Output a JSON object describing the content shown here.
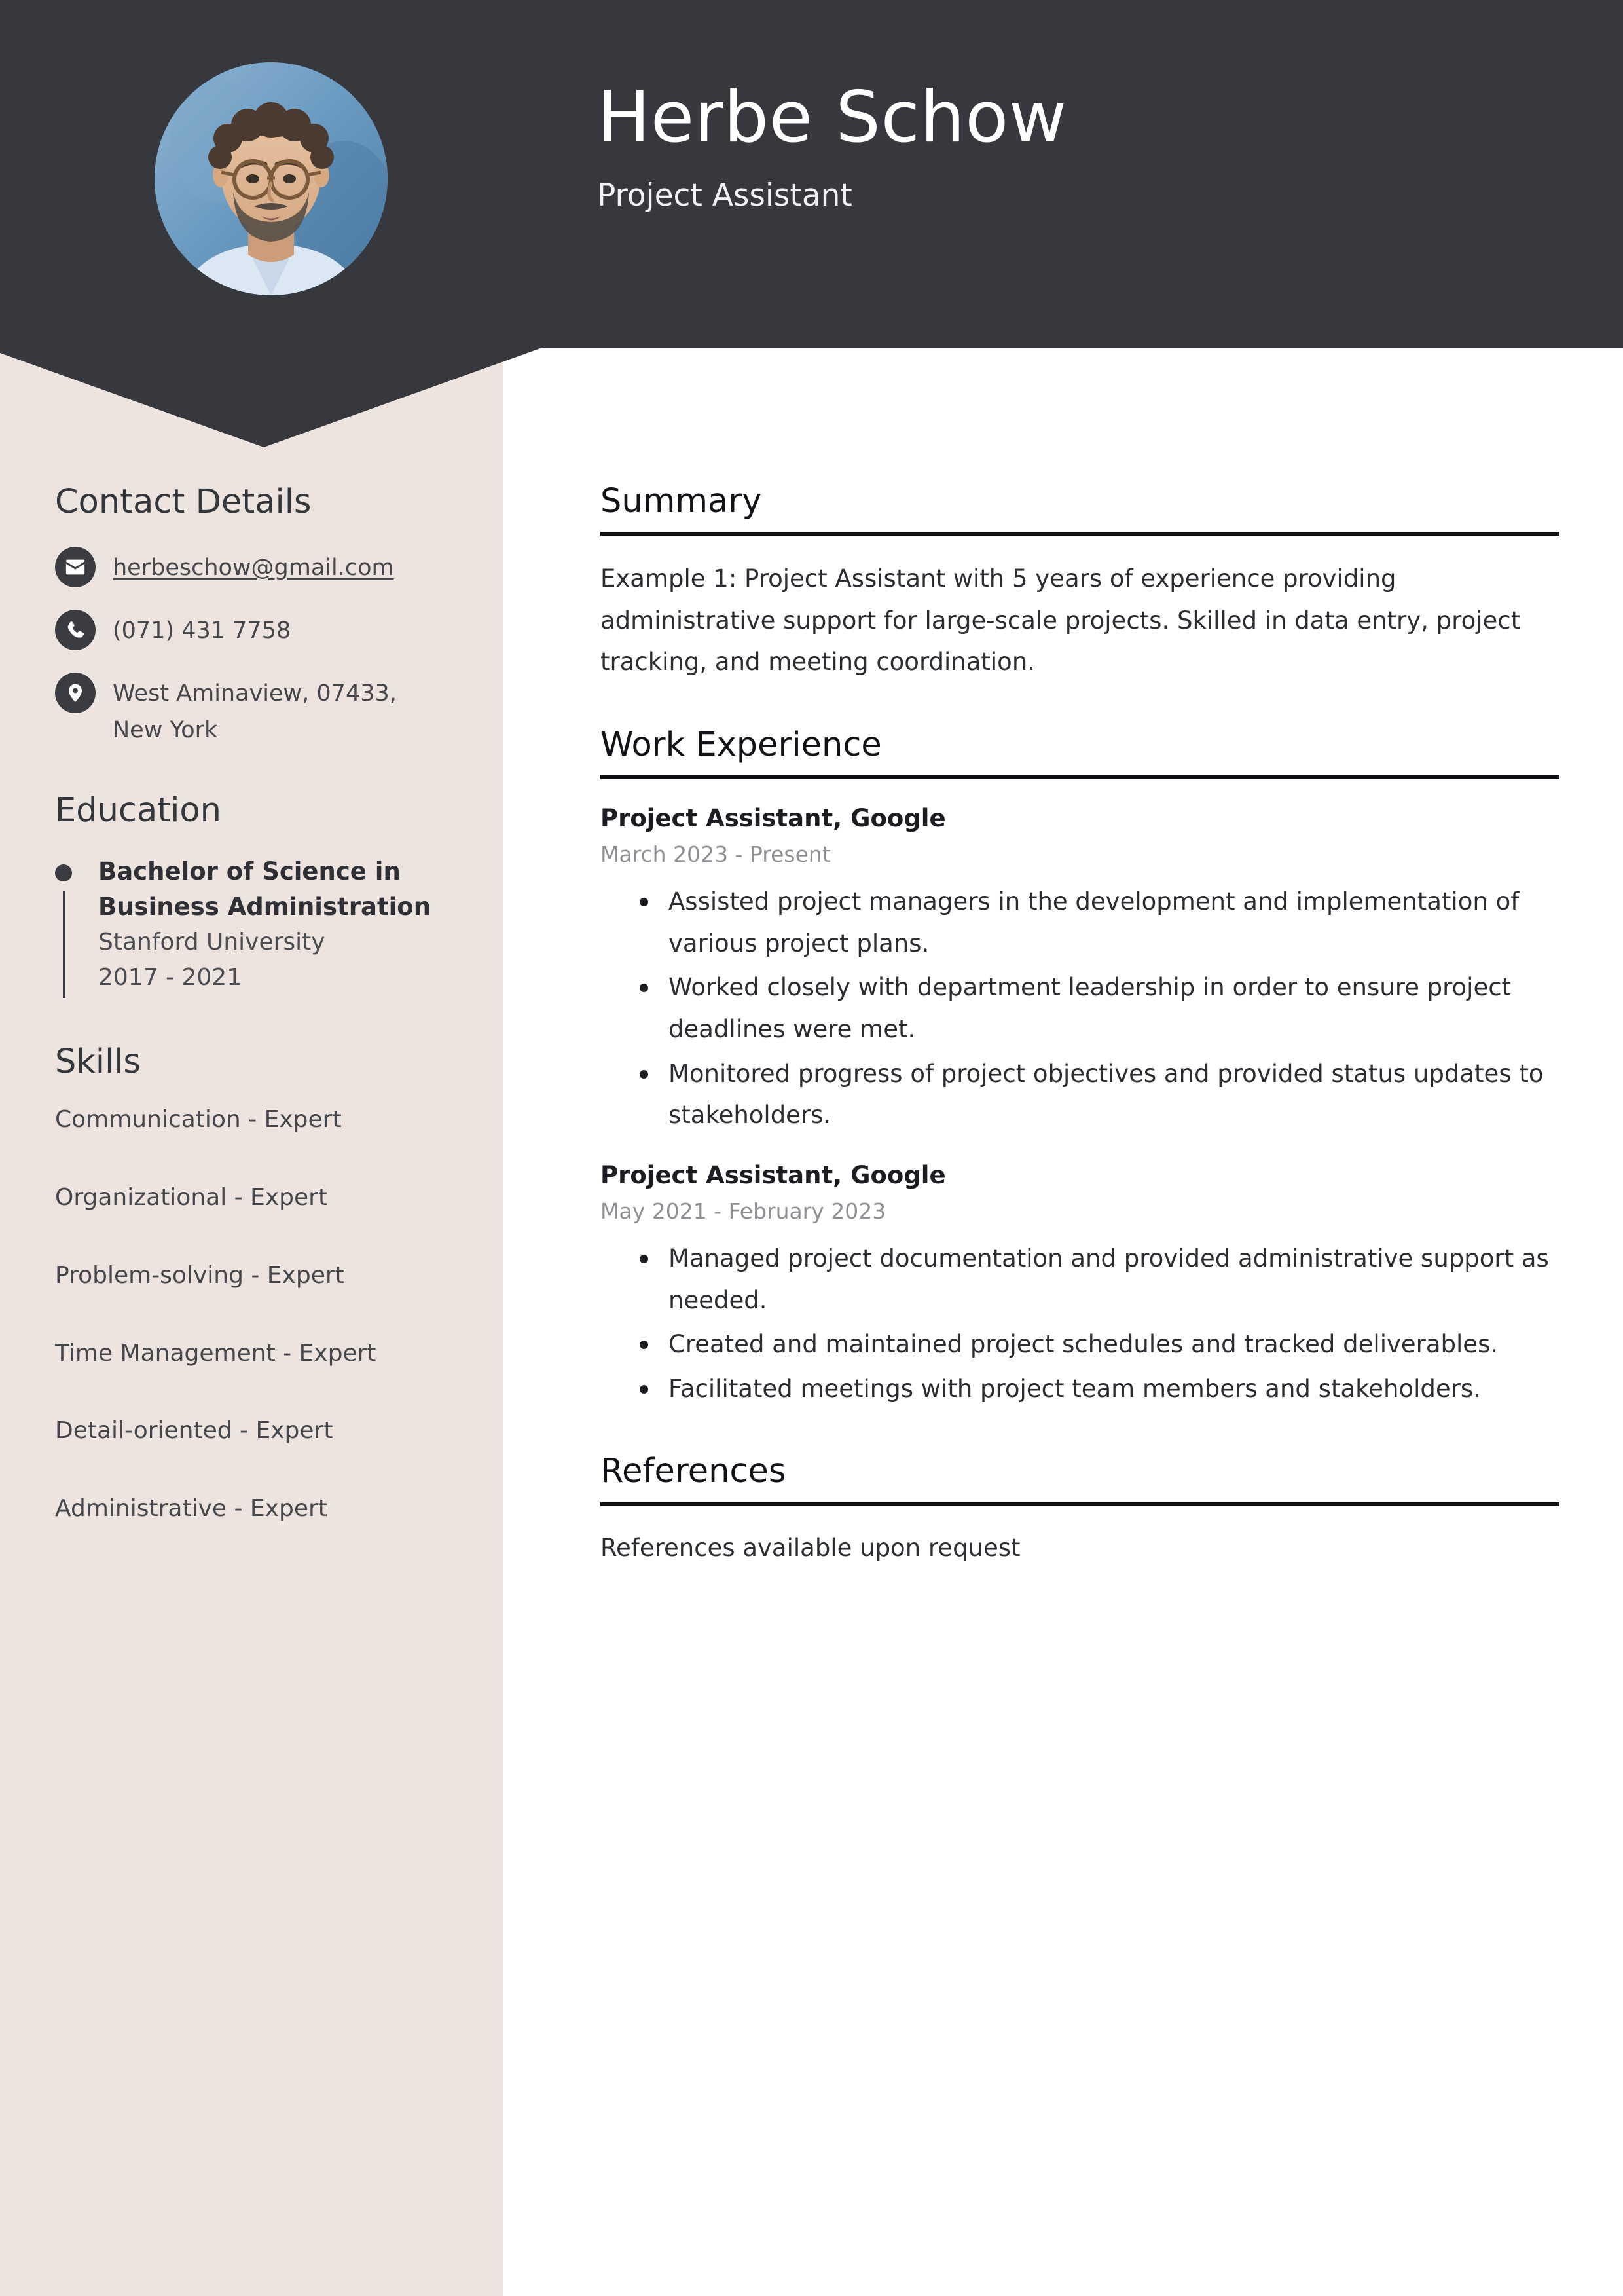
{
  "theme": {
    "header_bg": "#36383D",
    "sidebar_bg": "#EDE4DF",
    "page_bg": "#FFFFFF",
    "text_dark": "#2B2D32",
    "muted": "#8E9095"
  },
  "header": {
    "name": "Herbe Schow",
    "job_title": "Project Assistant",
    "avatar_alt": "profile-photo"
  },
  "sidebar": {
    "contact": {
      "heading": "Contact Details",
      "items": [
        {
          "icon": "envelope-icon",
          "value": "herbeschow@gmail.com",
          "is_link": true
        },
        {
          "icon": "phone-icon",
          "value": "(071) 431 7758",
          "is_link": false
        },
        {
          "icon": "map-pin-icon",
          "value": "West Aminaview, 07433, New York",
          "is_link": false
        }
      ]
    },
    "education": {
      "heading": "Education",
      "entries": [
        {
          "degree": "Bachelor of Science in Business Administration",
          "school": "Stanford University",
          "dates": "2017 - 2021"
        }
      ]
    },
    "skills": {
      "heading": "Skills",
      "items": [
        "Communication - Expert",
        "Organizational - Expert",
        "Problem-solving - Expert",
        "Time Management - Expert",
        "Detail-oriented - Expert",
        "Administrative - Expert"
      ]
    }
  },
  "main": {
    "summary": {
      "heading": "Summary",
      "text": "Example 1: Project Assistant with 5 years of experience providing administrative support for large-scale projects. Skilled in data entry, project tracking, and meeting coordination."
    },
    "work_experience": {
      "heading": "Work Experience",
      "jobs": [
        {
          "role": "Project Assistant, Google",
          "dates": "March 2023 - Present",
          "bullets": [
            "Assisted project managers in the development and implementation of various project plans.",
            "Worked closely with department leadership in order to ensure project deadlines were met.",
            "Monitored progress of project objectives and provided status updates to stakeholders."
          ]
        },
        {
          "role": "Project Assistant, Google",
          "dates": "May 2021 - February 2023",
          "bullets": [
            "Managed project documentation and provided administrative support as needed.",
            "Created and maintained project schedules and tracked deliverables.",
            "Facilitated meetings with project team members and stakeholders."
          ]
        }
      ]
    },
    "references": {
      "heading": "References",
      "text": "References available upon request"
    }
  }
}
